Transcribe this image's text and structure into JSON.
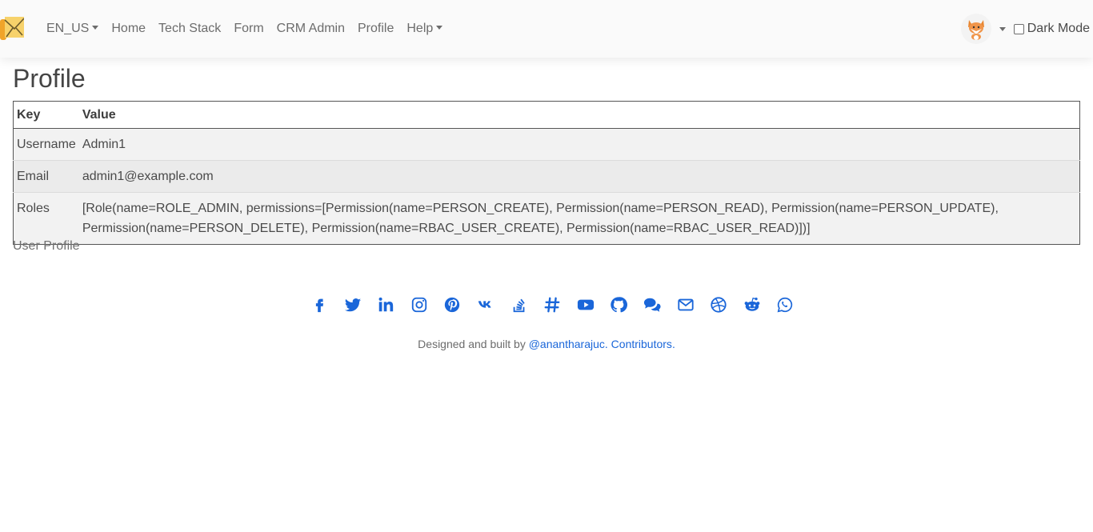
{
  "nav": {
    "language": "EN_US",
    "links": [
      "Home",
      "Tech Stack",
      "Form",
      "CRM Admin",
      "Profile"
    ],
    "help": "Help",
    "dark_mode_label": "Dark Mode",
    "dark_mode_checked": false
  },
  "page": {
    "title": "Profile",
    "table": {
      "headers": [
        "Key",
        "Value"
      ],
      "rows": [
        {
          "key": "Username",
          "value": "Admin1"
        },
        {
          "key": "Email",
          "value": "admin1@example.com"
        },
        {
          "key": "Roles",
          "value": "[Role(name=ROLE_ADMIN, permissions=[Permission(name=PERSON_CREATE), Permission(name=PERSON_READ), Permission(name=PERSON_UPDATE), Permission(name=PERSON_DELETE), Permission(name=RBAC_USER_CREATE), Permission(name=RBAC_USER_READ)])]"
        }
      ]
    },
    "caption": "User Profile"
  },
  "footer": {
    "social_icons": [
      "facebook-icon",
      "twitter-icon",
      "linkedin-icon",
      "instagram-icon",
      "pinterest-icon",
      "vk-icon",
      "stackoverflow-icon",
      "slack-icon",
      "youtube-icon",
      "github-icon",
      "chat-icon",
      "email-icon",
      "dribbble-icon",
      "reddit-icon",
      "whatsapp-icon"
    ],
    "credit_prefix": "Designed and built by ",
    "author_link": "@anantharajuc",
    "credit_mid": ". ",
    "contributors_link": "Contributors",
    "credit_suffix": "."
  },
  "colors": {
    "link": "#1a66d9",
    "navbar_bg": "#fafafa",
    "icon": "#1a66d9"
  }
}
